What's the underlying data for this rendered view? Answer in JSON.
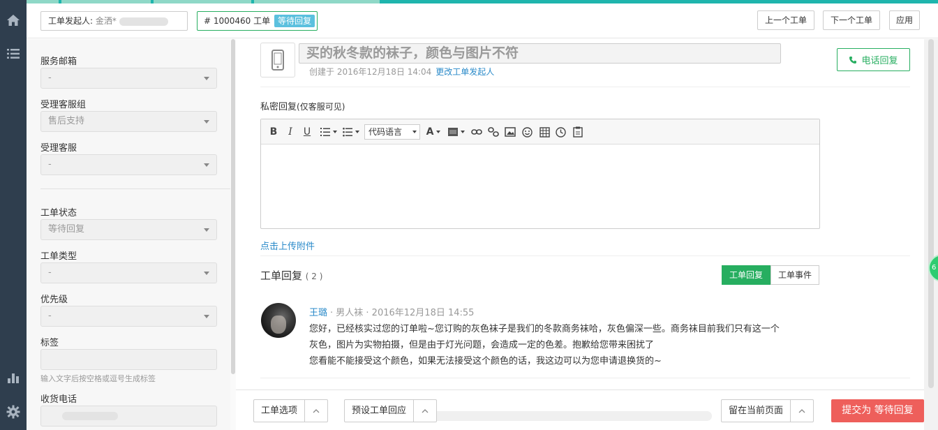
{
  "header": {
    "initiator_label": "工单发起人:",
    "initiator_value": "金洒*",
    "ticket_id": "# 1000460",
    "ticket_word": "工单",
    "status": "等待回复",
    "prev_label": "上一个工单",
    "next_label": "下一个工单",
    "apply_label": "应用"
  },
  "rail": {
    "icons": [
      "home-icon",
      "list-icon",
      "bar-chart-icon",
      "gear-icon"
    ]
  },
  "form": {
    "mailbox_label": "服务邮箱",
    "mailbox_value": "-",
    "group_label": "受理客服组",
    "group_value": "售后支持",
    "agent_label": "受理客服",
    "agent_value": "-",
    "status_label": "工单状态",
    "status_value": "等待回复",
    "type_label": "工单类型",
    "type_value": "-",
    "priority_label": "优先级",
    "priority_value": "-",
    "tags_label": "标签",
    "tags_hint": "输入文字后按空格或逗号生成标签",
    "phone_label": "收货电话"
  },
  "ticket": {
    "subject": "买的秋冬款的袜子，颜色与图片不符",
    "created": "创建于 2016年12月18日 14:04",
    "change_initiator": "更改工单发起人",
    "phone_reply": "电话回复"
  },
  "composer": {
    "private_label": "私密回复",
    "private_note": "(仅客服可见)",
    "code_language": "代码语言",
    "upload_label": "点击上传附件"
  },
  "replies": {
    "title": "工单回复",
    "count": "( 2 )",
    "tab_replies": "工单回复",
    "tab_events": "工单事件",
    "items": [
      {
        "author": "王璐",
        "meta": "· 男人袜 · 2016年12月18日 14:55",
        "lines": [
          "您好，已经核实过您的订单啦~您订购的灰色袜子是我们的冬款商务袜哈，灰色偏深一些。商务袜目前我们只有这一个",
          "灰色，图片为实物拍摄，但是由于灯光问题，会造成一定的色差。抱歉给您带来困扰了",
          "您看能不能接受这个颜色，如果无法接受这个颜色的话，我这边可以为您申请退换货的~"
        ]
      }
    ]
  },
  "bottom": {
    "options_label": "工单选项",
    "preset_label": "预设工单回应",
    "stay_label": "留在当前页面",
    "submit_label": "提交为 等待回复"
  },
  "colors": {
    "accent": "#27ae60",
    "link": "#2a8ac9",
    "danger": "#ee5f5b",
    "info": "#5bc0de",
    "rail": "#2f3e4e"
  }
}
